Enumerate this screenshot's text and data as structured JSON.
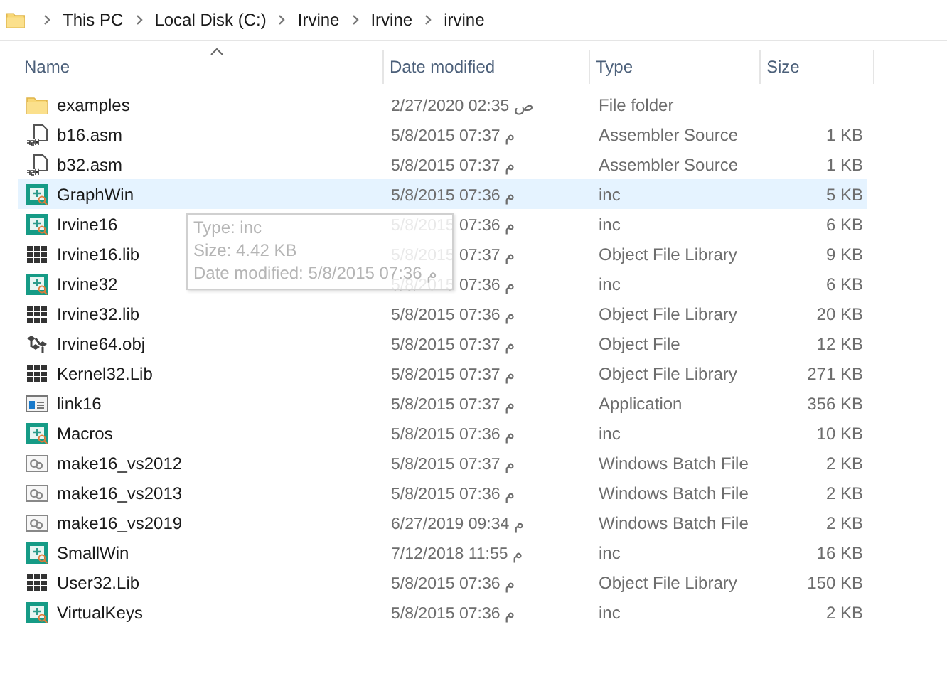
{
  "breadcrumb": [
    "This PC",
    "Local Disk (C:)",
    "Irvine",
    "Irvine",
    "irvine"
  ],
  "columns": [
    {
      "label": "Name",
      "sorted": true
    },
    {
      "label": "Date modified",
      "sorted": false
    },
    {
      "label": "Type",
      "sorted": false
    },
    {
      "label": "Size",
      "sorted": false
    }
  ],
  "rows": [
    {
      "kind": "folder",
      "name": "examples",
      "date": "2/27/2020 02:35 ص",
      "type": "File folder",
      "size": "",
      "selected": false
    },
    {
      "kind": "asm",
      "name": "b16.asm",
      "date": "5/8/2015 07:37 م",
      "type": "Assembler Source",
      "size": "1 KB",
      "selected": false
    },
    {
      "kind": "asm",
      "name": "b32.asm",
      "date": "5/8/2015 07:37 م",
      "type": "Assembler Source",
      "size": "1 KB",
      "selected": false
    },
    {
      "kind": "inc",
      "name": "GraphWin",
      "date": "5/8/2015 07:36 م",
      "type": "inc",
      "size": "5 KB",
      "selected": true
    },
    {
      "kind": "inc",
      "name": "Irvine16",
      "date": "5/8/2015 07:36 م",
      "type": "inc",
      "size": "6 KB",
      "selected": false
    },
    {
      "kind": "lib",
      "name": "Irvine16.lib",
      "date": "5/8/2015 07:37 م",
      "type": "Object File Library",
      "size": "9 KB",
      "selected": false
    },
    {
      "kind": "inc",
      "name": "Irvine32",
      "date": "5/8/2015 07:36 م",
      "type": "inc",
      "size": "6 KB",
      "selected": false
    },
    {
      "kind": "lib",
      "name": "Irvine32.lib",
      "date": "5/8/2015 07:36 م",
      "type": "Object File Library",
      "size": "20 KB",
      "selected": false
    },
    {
      "kind": "obj",
      "name": "Irvine64.obj",
      "date": "5/8/2015 07:37 م",
      "type": "Object File",
      "size": "12 KB",
      "selected": false
    },
    {
      "kind": "lib",
      "name": "Kernel32.Lib",
      "date": "5/8/2015 07:37 م",
      "type": "Object File Library",
      "size": "271 KB",
      "selected": false
    },
    {
      "kind": "app",
      "name": "link16",
      "date": "5/8/2015 07:37 م",
      "type": "Application",
      "size": "356 KB",
      "selected": false
    },
    {
      "kind": "inc",
      "name": "Macros",
      "date": "5/8/2015 07:36 م",
      "type": "inc",
      "size": "10 KB",
      "selected": false
    },
    {
      "kind": "bat",
      "name": "make16_vs2012",
      "date": "5/8/2015 07:37 م",
      "type": "Windows Batch File",
      "size": "2 KB",
      "selected": false
    },
    {
      "kind": "bat",
      "name": "make16_vs2013",
      "date": "5/8/2015 07:36 م",
      "type": "Windows Batch File",
      "size": "2 KB",
      "selected": false
    },
    {
      "kind": "bat",
      "name": "make16_vs2019",
      "date": "6/27/2019 09:34 م",
      "type": "Windows Batch File",
      "size": "2 KB",
      "selected": false
    },
    {
      "kind": "inc",
      "name": "SmallWin",
      "date": "7/12/2018 11:55 م",
      "type": "inc",
      "size": "16 KB",
      "selected": false
    },
    {
      "kind": "lib",
      "name": "User32.Lib",
      "date": "5/8/2015 07:36 م",
      "type": "Object File Library",
      "size": "150 KB",
      "selected": false
    },
    {
      "kind": "inc",
      "name": "VirtualKeys",
      "date": "5/8/2015 07:36 م",
      "type": "inc",
      "size": "2 KB",
      "selected": false
    }
  ],
  "tooltip": [
    "Type: inc",
    "Size: 4.42 KB",
    "Date modified: 5/8/2015 07:36 م"
  ]
}
